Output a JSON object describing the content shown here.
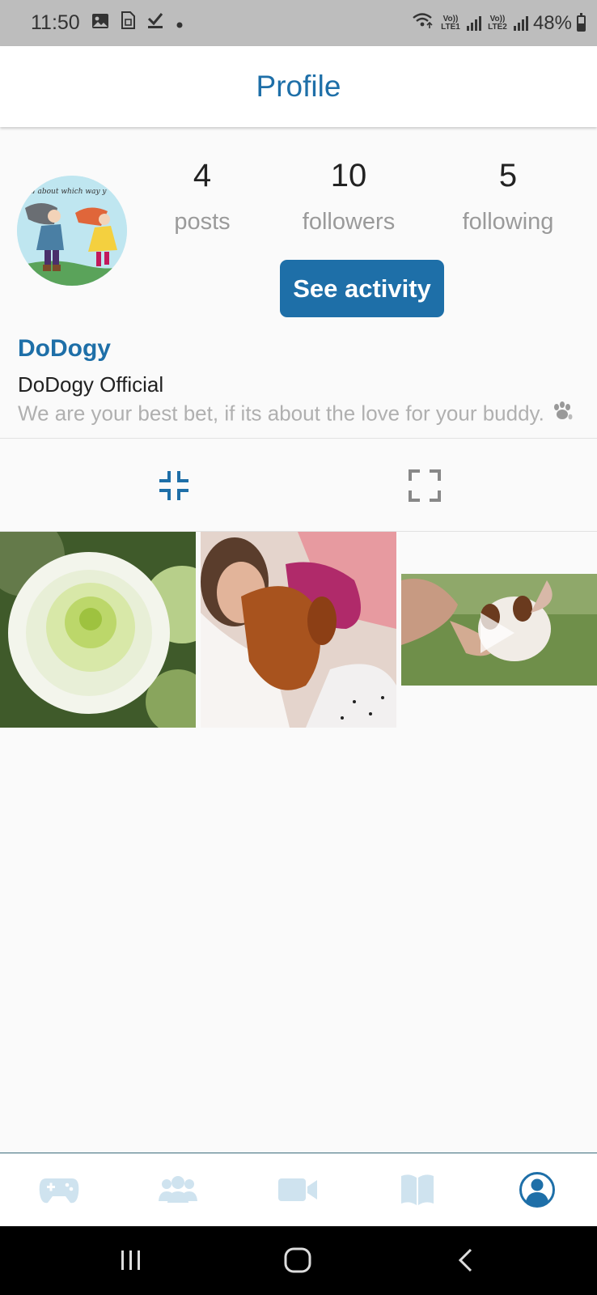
{
  "status_bar": {
    "time": "11:50",
    "battery_text": "48%",
    "sim1_label": "Vo)) LTE1",
    "sim2_label": "Vo)) LTE2",
    "icons": [
      "gallery-icon",
      "sim-card-icon",
      "download-done-icon",
      "dot-icon",
      "wifi-icon",
      "signal-icon",
      "battery-icon"
    ]
  },
  "header": {
    "title": "Profile"
  },
  "profile": {
    "avatar_caption": "ıd about which way y",
    "stats": [
      {
        "value": "4",
        "label": "posts"
      },
      {
        "value": "10",
        "label": "followers"
      },
      {
        "value": "5",
        "label": "following"
      }
    ],
    "activity_button": "See activity",
    "username": "DoDogy",
    "full_name": "DoDogy Official",
    "bio": "We are your best bet, if its about the love for your buddy.",
    "bio_icon": "paw-icon"
  },
  "view_toggle": {
    "active": "grid-compact",
    "items": [
      "compress-icon",
      "expand-icon"
    ]
  },
  "posts": [
    {
      "subject": "flower",
      "type": "photo"
    },
    {
      "subject": "girl with dog",
      "type": "photo"
    },
    {
      "subject": "puppy on grass",
      "type": "video"
    }
  ],
  "bottom_nav": {
    "items": [
      "gamepad-icon",
      "users-icon",
      "video-camera-icon",
      "book-icon",
      "profile-icon"
    ],
    "active": "profile-icon"
  },
  "colors": {
    "accent": "#1e6fa8",
    "inactive_icon": "#cfe3ef",
    "muted_text": "#9a9a9a",
    "background": "#fafafa"
  }
}
